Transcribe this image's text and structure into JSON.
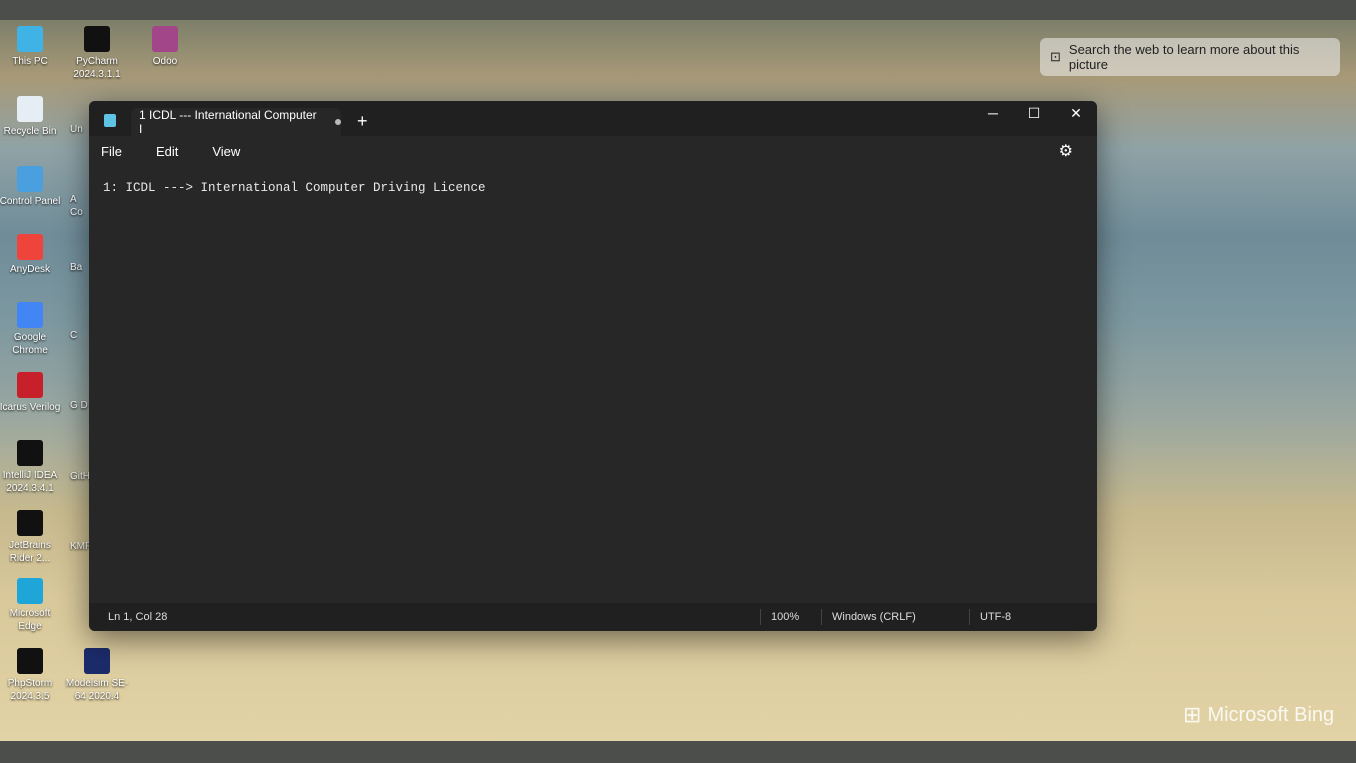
{
  "desktop": {
    "icons_col1": [
      {
        "label": "This PC",
        "color": "#3fb3e6"
      },
      {
        "label": "Recycle Bin",
        "color": "#e6eef5"
      },
      {
        "label": "Control Panel",
        "color": "#4aa0de"
      },
      {
        "label": "AnyDesk",
        "color": "#ef443b"
      },
      {
        "label": "Google Chrome",
        "color": "#4285f4"
      },
      {
        "label": "Icarus Verilog",
        "color": "#c8202a"
      },
      {
        "label": "IntelliJ IDEA 2024.3.4.1",
        "color": "#111"
      },
      {
        "label": "JetBrains Rider 2...",
        "color": "#111"
      },
      {
        "label": "Microsoft Edge",
        "color": "#1fa6d8"
      },
      {
        "label": "PhpStorm 2024.3.5",
        "color": "#111"
      }
    ],
    "icons_col2": [
      {
        "label": "PyCharm 2024.3.1.1",
        "color": "#111"
      },
      {
        "label": "Odoo",
        "color": "#a24689"
      },
      {
        "label": "Modelsim SE-64 2020.4",
        "color": "#1c2c6b"
      }
    ],
    "partial_labels": [
      "Un",
      "A Co",
      "Ba",
      "C",
      "G D",
      "GitH",
      "KMP"
    ],
    "search_text": "Search the web to learn more about this picture",
    "brand": "Microsoft Bing"
  },
  "notepad": {
    "tab_title": "1 ICDL --- International Computer I",
    "menu": [
      "File",
      "Edit",
      "View"
    ],
    "content": "1: ICDL ---> International Computer Driving Licence",
    "status": {
      "position": "Ln 1, Col 28",
      "zoom": "100%",
      "line_ending": "Windows (CRLF)",
      "encoding": "UTF-8"
    }
  }
}
